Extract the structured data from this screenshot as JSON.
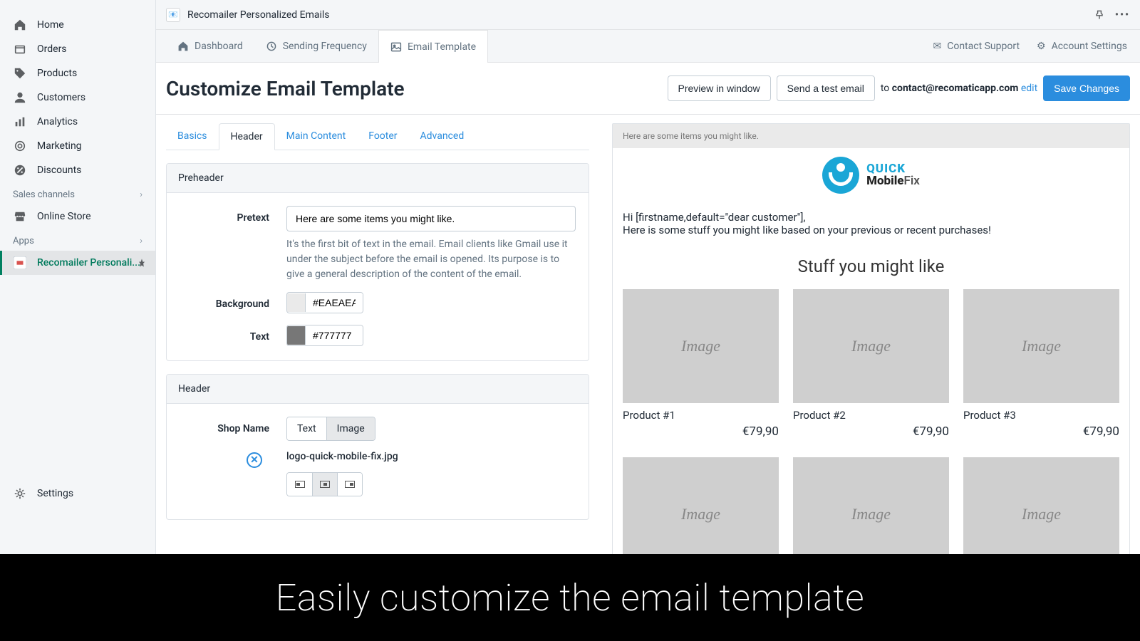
{
  "sidebar": {
    "items": [
      {
        "label": "Home",
        "icon": "home"
      },
      {
        "label": "Orders",
        "icon": "orders"
      },
      {
        "label": "Products",
        "icon": "products"
      },
      {
        "label": "Customers",
        "icon": "customers"
      },
      {
        "label": "Analytics",
        "icon": "analytics"
      },
      {
        "label": "Marketing",
        "icon": "marketing"
      },
      {
        "label": "Discounts",
        "icon": "discounts"
      }
    ],
    "sales_label": "Sales channels",
    "online_store": "Online Store",
    "apps_label": "Apps",
    "active_app": "Recomailer Personali...",
    "settings": "Settings"
  },
  "app_header": {
    "title": "Recomailer Personalized Emails"
  },
  "top_tabs": {
    "dashboard": "Dashboard",
    "frequency": "Sending Frequency",
    "template": "Email Template",
    "contact": "Contact Support",
    "account": "Account Settings"
  },
  "page": {
    "title": "Customize Email Template",
    "preview_btn": "Preview in window",
    "send_test_btn": "Send a test email",
    "to_label": "to",
    "to_email": "contact@recomaticapp.com",
    "edit": "edit",
    "save_btn": "Save Changes"
  },
  "sub_tabs": {
    "basics": "Basics",
    "header": "Header",
    "main": "Main Content",
    "footer": "Footer",
    "advanced": "Advanced"
  },
  "preheader": {
    "panel_title": "Preheader",
    "pretext_label": "Pretext",
    "pretext_value": "Here are some items you might like.",
    "pretext_help": "It's the first bit of text in the email. Email clients like Gmail use it under the subject before the email is opened. Its purpose is to give a general description of the content of the email.",
    "bg_label": "Background",
    "bg_value": "#EAEAEA",
    "text_label": "Text",
    "text_value": "#777777"
  },
  "header_panel": {
    "title": "Header",
    "shop_label": "Shop Name",
    "seg_text": "Text",
    "seg_image": "Image",
    "filename": "logo-quick-mobile-fix.jpg"
  },
  "preview": {
    "pretext": "Here are some items you might like.",
    "logo_line1": "QUICK",
    "logo_line2a": "Mobile",
    "logo_line2b": "Fix",
    "greeting": "Hi [firstname,default=\"dear customer\"],",
    "intro": "Here is some stuff you might like based on your previous or recent purchases!",
    "section_title": "Stuff you might like",
    "img_placeholder": "Image",
    "products": [
      {
        "name": "Product #1",
        "price": "€79,90"
      },
      {
        "name": "Product #2",
        "price": "€79,90"
      },
      {
        "name": "Product #3",
        "price": "€79,90"
      }
    ]
  },
  "banner": "Easily customize the email template"
}
